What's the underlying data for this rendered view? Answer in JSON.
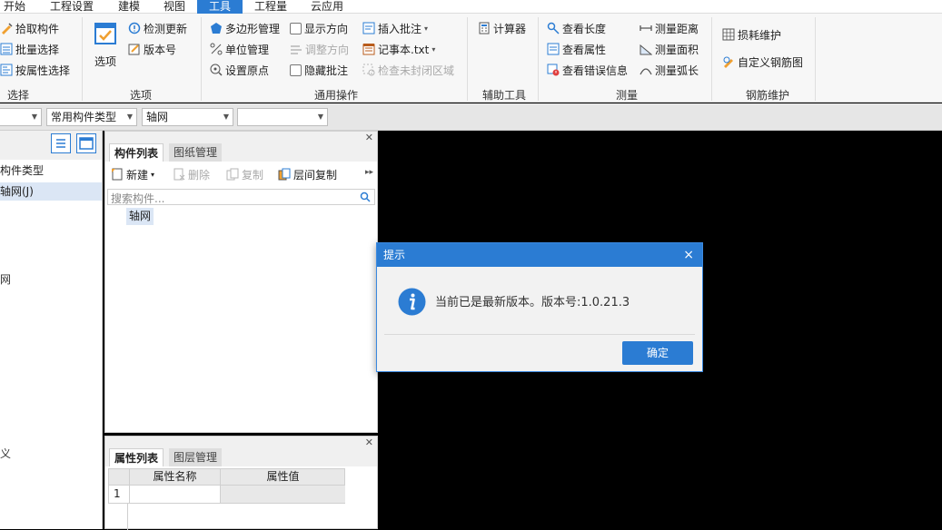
{
  "menubar": {
    "items": [
      {
        "label": "开始"
      },
      {
        "label": "工程设置"
      },
      {
        "label": "建模"
      },
      {
        "label": "视图"
      },
      {
        "label": "工具"
      },
      {
        "label": "工程量"
      },
      {
        "label": "云应用"
      }
    ],
    "active_index": 4
  },
  "ribbon": {
    "select_group": {
      "items": [
        "拾取构件",
        "批量选择",
        "按属性选择"
      ],
      "label": "选择"
    },
    "options_group": {
      "big_button": "选项",
      "items": [
        "检测更新",
        "版本号"
      ],
      "label": "选项"
    },
    "common_group": {
      "col1": [
        "多边形管理",
        "单位管理",
        "设置原点"
      ],
      "col2": [
        "显示方向",
        "调整方向",
        "隐藏批注"
      ],
      "col3": [
        "插入批注",
        "记事本.txt",
        "检查未封闭区域"
      ],
      "label": "通用操作"
    },
    "aux_group": {
      "items": [
        "计算器"
      ],
      "label": "辅助工具"
    },
    "measure_group": {
      "col1": [
        "查看长度",
        "查看属性",
        "查看错误信息"
      ],
      "col2": [
        "测量距离",
        "测量面积",
        "测量弧长"
      ],
      "label": "测量"
    },
    "rebar_group": {
      "items": [
        "损耗维护",
        "自定义钢筋图"
      ],
      "label": "钢筋维护"
    }
  },
  "filterbar": {
    "combo1": "",
    "combo2": "常用构件类型",
    "combo3": "轴网",
    "combo4": ""
  },
  "leftpanel": {
    "items": [
      "构件类型",
      "轴网(J)"
    ],
    "fragments": [
      "网",
      "义"
    ]
  },
  "component_panel": {
    "tabs": [
      "构件列表",
      "图纸管理"
    ],
    "toolbar": {
      "new": "新建",
      "delete": "删除",
      "copy": "复制",
      "floor_copy": "层间复制"
    },
    "search_placeholder": "搜索构件...",
    "items": [
      "轴网"
    ]
  },
  "property_panel": {
    "tabs": [
      "属性列表",
      "图层管理"
    ],
    "columns": [
      "属性名称",
      "属性值"
    ],
    "rows": [
      {
        "index": "1",
        "name": "",
        "value": ""
      }
    ]
  },
  "dialog": {
    "title": "提示",
    "close": "×",
    "message": "当前已是最新版本。版本号:1.0.21.3",
    "ok": "确定"
  },
  "colors": {
    "accent": "#2b7cd3",
    "canvas": "#000000",
    "info_icon": "#2b7cd3"
  }
}
